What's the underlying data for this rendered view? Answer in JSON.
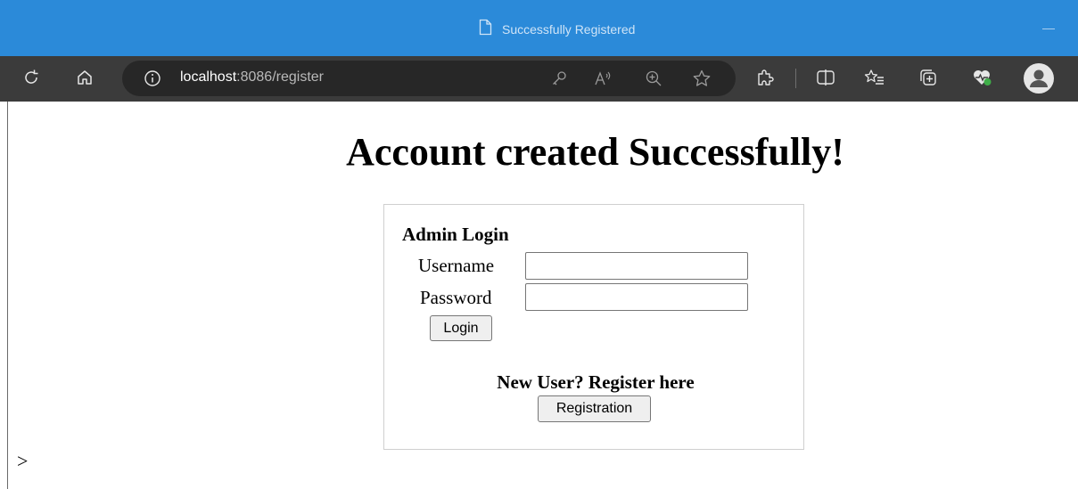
{
  "window": {
    "title": "Successfully Registered"
  },
  "toolbar": {
    "url_host": "localhost",
    "url_path": ":8086/register"
  },
  "page": {
    "heading": "Account created Successfully!",
    "login_box": {
      "heading": "Admin Login",
      "username_label": "Username",
      "username_value": "",
      "password_label": "Password",
      "password_value": "",
      "login_button": "Login",
      "new_user_text": "New User? Register here",
      "registration_button": "Registration"
    },
    "stray_text": ">"
  },
  "colors": {
    "titlebar": "#2b8ad9",
    "toolbar": "#3b3b3b",
    "addressbar": "#272727"
  }
}
